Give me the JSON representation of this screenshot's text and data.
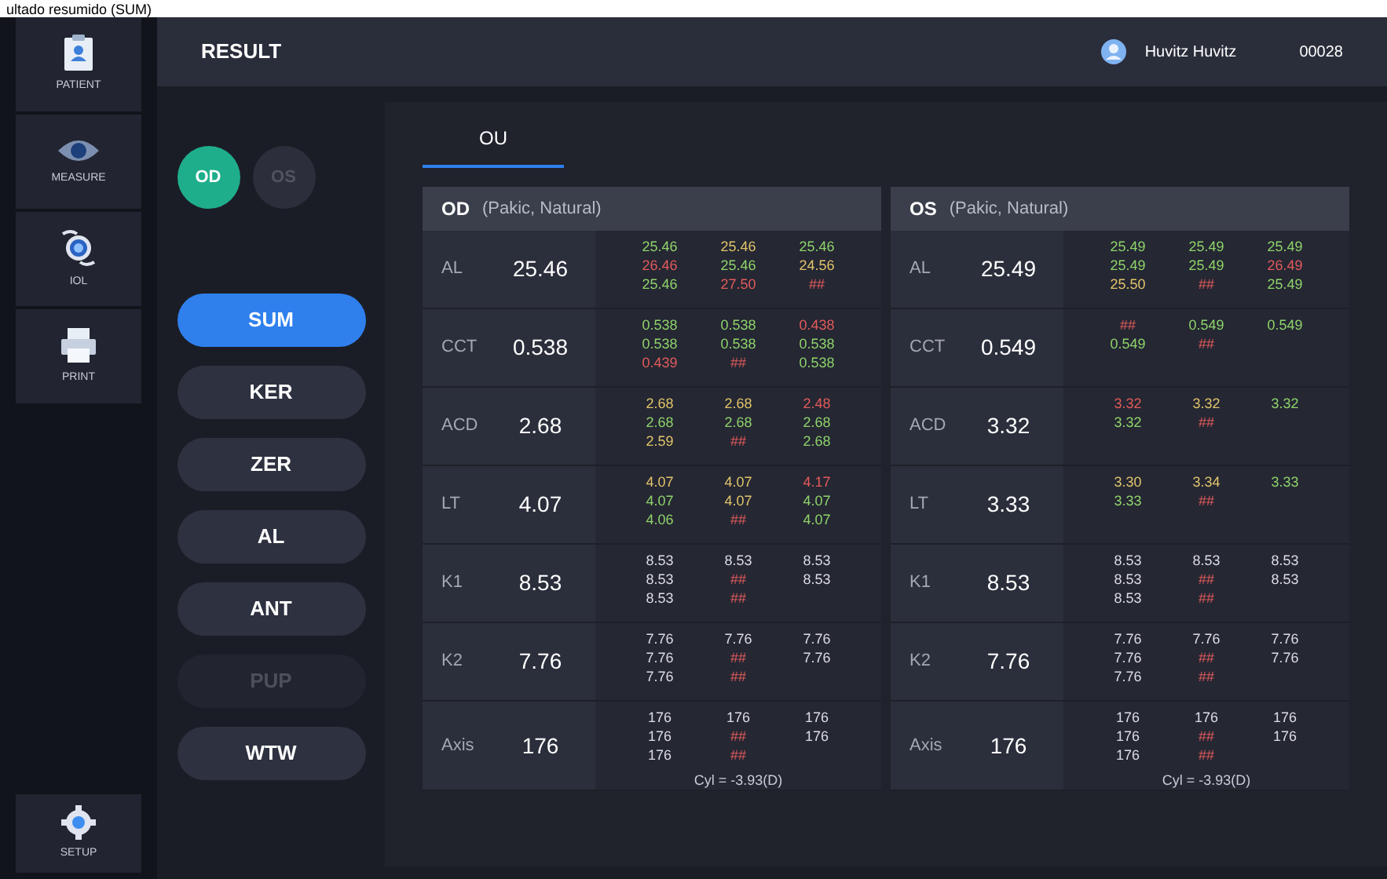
{
  "caption": "ultado resumido (SUM)",
  "nav": [
    {
      "label": "PATIENT",
      "kind": "patient"
    },
    {
      "label": "MEASURE",
      "kind": "measure"
    },
    {
      "label": "IOL",
      "kind": "iol"
    },
    {
      "label": "PRINT",
      "kind": "print"
    }
  ],
  "setup": {
    "label": "SETUP"
  },
  "header": {
    "title": "RESULT",
    "user": "Huvitz Huvitz",
    "patient_id": "00028"
  },
  "eyes": [
    {
      "label": "OD",
      "selected": true
    },
    {
      "label": "OS",
      "selected": false
    }
  ],
  "modes": [
    {
      "label": "SUM",
      "selected": true,
      "disabled": false
    },
    {
      "label": "KER",
      "selected": false,
      "disabled": false
    },
    {
      "label": "ZER",
      "selected": false,
      "disabled": false
    },
    {
      "label": "AL",
      "selected": false,
      "disabled": false
    },
    {
      "label": "ANT",
      "selected": false,
      "disabled": false
    },
    {
      "label": "PUP",
      "selected": false,
      "disabled": true
    },
    {
      "label": "WTW",
      "selected": false,
      "disabled": false
    }
  ],
  "tabs": [
    {
      "label": "OU",
      "selected": true
    }
  ],
  "tables": [
    {
      "eye": "OD",
      "condition": "(Pakic, Natural)",
      "footnote": "Cyl = -3.93(D)",
      "rows": [
        {
          "label": "AL",
          "value": "25.46",
          "readings": [
            [
              {
                "text": "25.46",
                "color": "#8ed36a"
              },
              {
                "text": "26.46",
                "color": "#e25b5b"
              },
              {
                "text": "25.46",
                "color": "#8ed36a"
              }
            ],
            [
              {
                "text": "25.46",
                "color": "#e0c46a"
              },
              {
                "text": "25.46",
                "color": "#8ed36a"
              },
              {
                "text": "27.50",
                "color": "#e25b5b"
              }
            ],
            [
              {
                "text": "25.46",
                "color": "#8ed36a"
              },
              {
                "text": "24.56",
                "color": "#e0c46a"
              },
              {
                "text": "##",
                "color": "#e25b5b"
              }
            ]
          ]
        },
        {
          "label": "CCT",
          "value": "0.538",
          "readings": [
            [
              {
                "text": "0.538",
                "color": "#8ed36a"
              },
              {
                "text": "0.538",
                "color": "#8ed36a"
              },
              {
                "text": "0.439",
                "color": "#e25b5b"
              }
            ],
            [
              {
                "text": "0.538",
                "color": "#8ed36a"
              },
              {
                "text": "0.538",
                "color": "#8ed36a"
              },
              {
                "text": "##",
                "color": "#e25b5b"
              }
            ],
            [
              {
                "text": "0.438",
                "color": "#e25b5b"
              },
              {
                "text": "0.538",
                "color": "#8ed36a"
              },
              {
                "text": "0.538",
                "color": "#8ed36a"
              }
            ]
          ]
        },
        {
          "label": "ACD",
          "value": "2.68",
          "readings": [
            [
              {
                "text": "2.68",
                "color": "#e0c46a"
              },
              {
                "text": "2.68",
                "color": "#8ed36a"
              },
              {
                "text": "2.59",
                "color": "#e0c46a"
              }
            ],
            [
              {
                "text": "2.68",
                "color": "#e0c46a"
              },
              {
                "text": "2.68",
                "color": "#8ed36a"
              },
              {
                "text": "##",
                "color": "#e25b5b"
              }
            ],
            [
              {
                "text": "2.48",
                "color": "#e25b5b"
              },
              {
                "text": "2.68",
                "color": "#8ed36a"
              },
              {
                "text": "2.68",
                "color": "#8ed36a"
              }
            ]
          ]
        },
        {
          "label": "LT",
          "value": "4.07",
          "readings": [
            [
              {
                "text": "4.07",
                "color": "#e0c46a"
              },
              {
                "text": "4.07",
                "color": "#8ed36a"
              },
              {
                "text": "4.06",
                "color": "#8ed36a"
              }
            ],
            [
              {
                "text": "4.07",
                "color": "#e0c46a"
              },
              {
                "text": "4.07",
                "color": "#e0c46a"
              },
              {
                "text": "##",
                "color": "#e25b5b"
              }
            ],
            [
              {
                "text": "4.17",
                "color": "#e25b5b"
              },
              {
                "text": "4.07",
                "color": "#8ed36a"
              },
              {
                "text": "4.07",
                "color": "#8ed36a"
              }
            ]
          ]
        },
        {
          "label": "K1",
          "value": "8.53",
          "readings": [
            [
              {
                "text": "8.53",
                "color": "#dcdce4"
              },
              {
                "text": "8.53",
                "color": "#dcdce4"
              },
              {
                "text": "8.53",
                "color": "#dcdce4"
              }
            ],
            [
              {
                "text": "8.53",
                "color": "#dcdce4"
              },
              {
                "text": "##",
                "color": "#e25b5b"
              },
              {
                "text": "##",
                "color": "#e25b5b"
              }
            ],
            [
              {
                "text": "8.53",
                "color": "#dcdce4"
              },
              {
                "text": "8.53",
                "color": "#dcdce4"
              }
            ]
          ]
        },
        {
          "label": "K2",
          "value": "7.76",
          "readings": [
            [
              {
                "text": "7.76",
                "color": "#dcdce4"
              },
              {
                "text": "7.76",
                "color": "#dcdce4"
              },
              {
                "text": "7.76",
                "color": "#dcdce4"
              }
            ],
            [
              {
                "text": "7.76",
                "color": "#dcdce4"
              },
              {
                "text": "##",
                "color": "#e25b5b"
              },
              {
                "text": "##",
                "color": "#e25b5b"
              }
            ],
            [
              {
                "text": "7.76",
                "color": "#dcdce4"
              },
              {
                "text": "7.76",
                "color": "#dcdce4"
              }
            ]
          ]
        },
        {
          "label": "Axis",
          "value": "176",
          "readings": [
            [
              {
                "text": "176",
                "color": "#dcdce4"
              },
              {
                "text": "176",
                "color": "#dcdce4"
              },
              {
                "text": "176",
                "color": "#dcdce4"
              }
            ],
            [
              {
                "text": "176",
                "color": "#dcdce4"
              },
              {
                "text": "##",
                "color": "#e25b5b"
              },
              {
                "text": "##",
                "color": "#e25b5b"
              }
            ],
            [
              {
                "text": "176",
                "color": "#dcdce4"
              },
              {
                "text": "176",
                "color": "#dcdce4"
              }
            ]
          ]
        }
      ]
    },
    {
      "eye": "OS",
      "condition": "(Pakic, Natural)",
      "footnote": "Cyl = -3.93(D)",
      "rows": [
        {
          "label": "AL",
          "value": "25.49",
          "readings": [
            [
              {
                "text": "25.49",
                "color": "#8ed36a"
              },
              {
                "text": "25.49",
                "color": "#8ed36a"
              },
              {
                "text": "25.50",
                "color": "#e0c46a"
              }
            ],
            [
              {
                "text": "25.49",
                "color": "#8ed36a"
              },
              {
                "text": "25.49",
                "color": "#8ed36a"
              },
              {
                "text": "##",
                "color": "#e25b5b"
              }
            ],
            [
              {
                "text": "25.49",
                "color": "#8ed36a"
              },
              {
                "text": "26.49",
                "color": "#e25b5b"
              },
              {
                "text": "25.49",
                "color": "#8ed36a"
              }
            ]
          ]
        },
        {
          "label": "CCT",
          "value": "0.549",
          "readings": [
            [
              {
                "text": "##",
                "color": "#e25b5b"
              },
              {
                "text": "0.549",
                "color": "#8ed36a"
              }
            ],
            [
              {
                "text": "0.549",
                "color": "#8ed36a"
              },
              {
                "text": "##",
                "color": "#e25b5b"
              }
            ],
            [
              {
                "text": "0.549",
                "color": "#8ed36a"
              }
            ]
          ]
        },
        {
          "label": "ACD",
          "value": "3.32",
          "readings": [
            [
              {
                "text": "3.32",
                "color": "#e25b5b"
              },
              {
                "text": "3.32",
                "color": "#8ed36a"
              }
            ],
            [
              {
                "text": "3.32",
                "color": "#e0c46a"
              },
              {
                "text": "##",
                "color": "#e25b5b"
              }
            ],
            [
              {
                "text": "3.32",
                "color": "#8ed36a"
              }
            ]
          ]
        },
        {
          "label": "LT",
          "value": "3.33",
          "readings": [
            [
              {
                "text": "3.30",
                "color": "#e0c46a"
              },
              {
                "text": "3.33",
                "color": "#8ed36a"
              }
            ],
            [
              {
                "text": "3.34",
                "color": "#e0c46a"
              },
              {
                "text": "##",
                "color": "#e25b5b"
              }
            ],
            [
              {
                "text": "3.33",
                "color": "#8ed36a"
              }
            ]
          ]
        },
        {
          "label": "K1",
          "value": "8.53",
          "readings": [
            [
              {
                "text": "8.53",
                "color": "#dcdce4"
              },
              {
                "text": "8.53",
                "color": "#dcdce4"
              },
              {
                "text": "8.53",
                "color": "#dcdce4"
              }
            ],
            [
              {
                "text": "8.53",
                "color": "#dcdce4"
              },
              {
                "text": "##",
                "color": "#e25b5b"
              },
              {
                "text": "##",
                "color": "#e25b5b"
              }
            ],
            [
              {
                "text": "8.53",
                "color": "#dcdce4"
              },
              {
                "text": "8.53",
                "color": "#dcdce4"
              }
            ]
          ]
        },
        {
          "label": "K2",
          "value": "7.76",
          "readings": [
            [
              {
                "text": "7.76",
                "color": "#dcdce4"
              },
              {
                "text": "7.76",
                "color": "#dcdce4"
              },
              {
                "text": "7.76",
                "color": "#dcdce4"
              }
            ],
            [
              {
                "text": "7.76",
                "color": "#dcdce4"
              },
              {
                "text": "##",
                "color": "#e25b5b"
              },
              {
                "text": "##",
                "color": "#e25b5b"
              }
            ],
            [
              {
                "text": "7.76",
                "color": "#dcdce4"
              },
              {
                "text": "7.76",
                "color": "#dcdce4"
              }
            ]
          ]
        },
        {
          "label": "Axis",
          "value": "176",
          "readings": [
            [
              {
                "text": "176",
                "color": "#dcdce4"
              },
              {
                "text": "176",
                "color": "#dcdce4"
              },
              {
                "text": "176",
                "color": "#dcdce4"
              }
            ],
            [
              {
                "text": "176",
                "color": "#dcdce4"
              },
              {
                "text": "##",
                "color": "#e25b5b"
              },
              {
                "text": "##",
                "color": "#e25b5b"
              }
            ],
            [
              {
                "text": "176",
                "color": "#dcdce4"
              },
              {
                "text": "176",
                "color": "#dcdce4"
              }
            ]
          ]
        }
      ]
    }
  ]
}
